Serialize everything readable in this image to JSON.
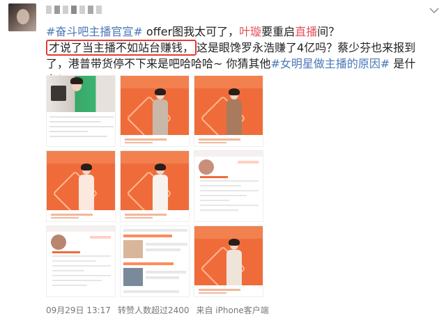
{
  "post": {
    "segments": [
      {
        "text": "#奋斗吧主播官宣#",
        "style": "tag"
      },
      {
        "text": " offer图我太可了，",
        "style": "plain"
      },
      {
        "text": "叶璇",
        "style": "kw"
      },
      {
        "text": "要重启",
        "style": "plain"
      },
      {
        "text": "直播",
        "style": "kw"
      },
      {
        "text": "间？",
        "style": "plain"
      },
      {
        "text": "才说了当主播不如站台赚钱，",
        "style": "hl"
      },
      {
        "text": "这是眼馋罗永浩赚了4亿吗？蔡少芬也来报到了，港普带货停不下来是吧哈哈哈~ 你猜其他",
        "style": "plain"
      },
      {
        "text": "#女明星做主播的原因#",
        "style": "tag"
      },
      {
        "text": " 是什么？",
        "style": "plain"
      }
    ]
  },
  "meta": {
    "date": "09月29日 13:17",
    "reposts": "转赞人数超过2400",
    "source": "来自 iPhone客户端"
  },
  "colors": {
    "tag": "#4a77b8",
    "keyword": "#e5515b",
    "highlight_box": "#e53935",
    "poster": "#ef6c3a"
  },
  "icons": [
    "more-icon"
  ]
}
